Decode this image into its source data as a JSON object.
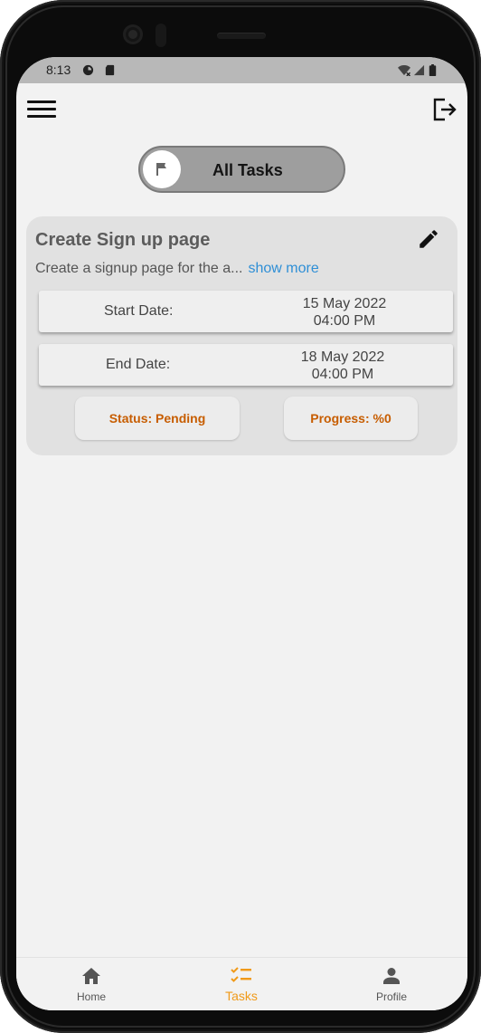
{
  "status_bar": {
    "time": "8:13"
  },
  "filter": {
    "label": "All Tasks"
  },
  "task": {
    "title": "Create Sign up page",
    "description": "Create a signup page for the a...",
    "show_more": "show more",
    "start_label": "Start Date:",
    "start_date": "15 May 2022",
    "start_time": "04:00 PM",
    "end_label": "End Date:",
    "end_date": "18 May 2022",
    "end_time": "04:00 PM",
    "status": "Status: Pending",
    "progress": "Progress: %0"
  },
  "bottom_nav": {
    "items": [
      {
        "label": "Home"
      },
      {
        "label": "Tasks"
      },
      {
        "label": "Profile"
      }
    ],
    "active_color": "#f09a1a"
  },
  "colors": {
    "status_text": "#c75d00",
    "link": "#2f8fd6"
  }
}
